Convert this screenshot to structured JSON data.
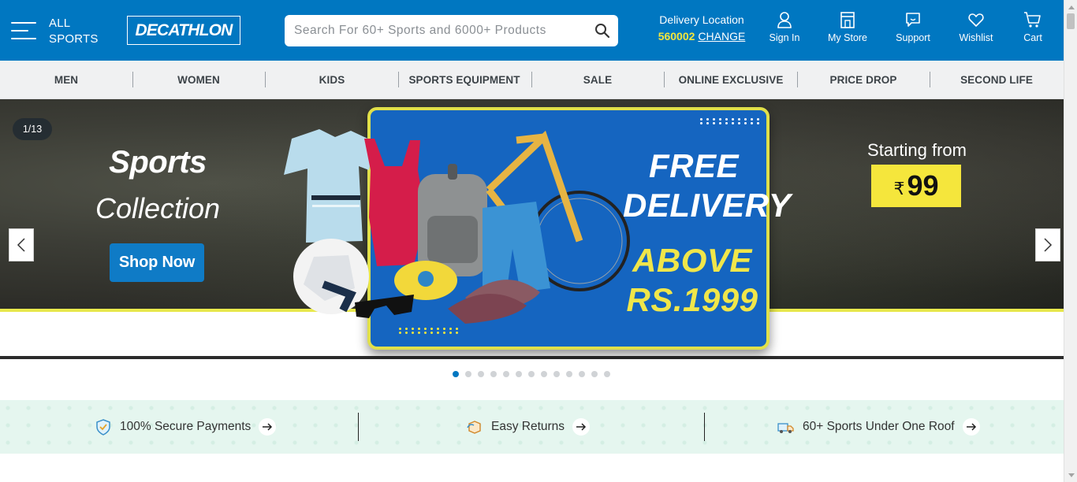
{
  "header": {
    "menu_label_line1": "ALL",
    "menu_label_line2": "SPORTS",
    "logo_text": "DECATHLON",
    "search_placeholder": "Search For 60+ Sports and 6000+ Products",
    "search_value": "",
    "delivery_label": "Delivery Location",
    "pincode": "560002",
    "change_label": "CHANGE",
    "actions": [
      {
        "label": "Sign In",
        "icon": "user-icon"
      },
      {
        "label": "My Store",
        "icon": "store-icon"
      },
      {
        "label": "Support",
        "icon": "support-chat-icon"
      },
      {
        "label": "Wishlist",
        "icon": "heart-icon"
      },
      {
        "label": "Cart",
        "icon": "cart-icon"
      }
    ],
    "brand_color": "#0077c1"
  },
  "nav": {
    "items": [
      "MEN",
      "WOMEN",
      "KIDS",
      "SPORTS EQUIPMENT",
      "SALE",
      "ONLINE EXCLUSIVE",
      "PRICE DROP",
      "SECOND LIFE"
    ]
  },
  "hero": {
    "counter": "1/13",
    "title": "Sports",
    "subtitle": "Collection",
    "cta": "Shop Now",
    "promo_line1": "FREE",
    "promo_line2": "DELIVERY",
    "promo_line3": "ABOVE",
    "promo_line4": "RS.1999",
    "starting_from": "Starting from",
    "currency": "₹",
    "price": "99",
    "slide_count": 13,
    "active_slide": 1
  },
  "usp": {
    "items": [
      {
        "label": "100% Secure Payments",
        "icon": "shield-check-icon"
      },
      {
        "label": "Easy Returns",
        "icon": "return-box-icon"
      },
      {
        "label": "60+ Sports Under One Roof",
        "icon": "delivery-truck-icon"
      }
    ]
  }
}
